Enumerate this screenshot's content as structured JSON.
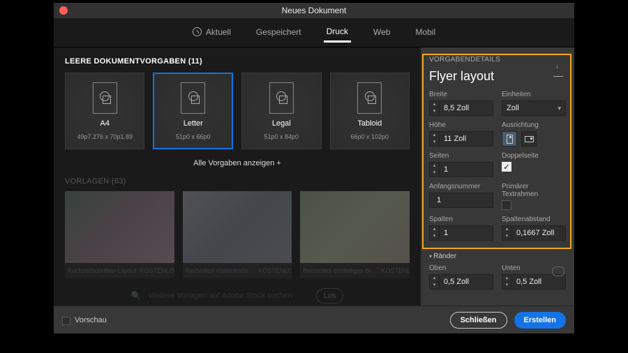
{
  "title": "Neues Dokument",
  "tabs": {
    "recent": "Aktuell",
    "saved": "Gespeichert",
    "print": "Druck",
    "web": "Web",
    "mobile": "Mobil"
  },
  "presetsHeader": "LEERE DOKUMENTVORGABEN (11)",
  "presets": [
    {
      "name": "A4",
      "sub": "49p7.276 x 70p1.89"
    },
    {
      "name": "Letter",
      "sub": "51p0 x 66p0"
    },
    {
      "name": "Legal",
      "sub": "51p0 x 84p0"
    },
    {
      "name": "Tabloid",
      "sub": "66p0 x 102p0"
    }
  ],
  "showAll": "Alle Vorgaben anzeigen +",
  "templatesHeader": "VORLAGEN (63)",
  "templates": [
    {
      "label": "Kochzeitschriften-Layout",
      "tag": "KOSTENLOS"
    },
    {
      "label": "Reizvolles Visitenkarte…",
      "tag": "KOSTENLOS"
    },
    {
      "label": "Reizvolles dreiteiliges Br…",
      "tag": "KOSTENLOS"
    }
  ],
  "stockSearch": {
    "placeholder": "Weitere Vorlagen auf Adobe Stock suchen",
    "go": "Los"
  },
  "details": {
    "title": "VORGABENDETAILS",
    "name": "Flyer layout",
    "widthLabel": "Breite",
    "widthValue": "8,5 Zoll",
    "unitsLabel": "Einheiten",
    "unitsValue": "Zoll",
    "heightLabel": "Höhe",
    "heightValue": "11 Zoll",
    "orientationLabel": "Ausrichtung",
    "pagesLabel": "Seiten",
    "pagesValue": "1",
    "facingLabel": "Doppelseite",
    "facingChecked": true,
    "startLabel": "Anfangsnummer",
    "startValue": "1",
    "primaryLabel": "Primärer Textrahmen",
    "primaryChecked": false,
    "columnsLabel": "Spalten",
    "columnsValue": "1",
    "gutterLabel": "Spaltenabstand",
    "gutterValue": "0,1667 Zoll",
    "marginsTitle": "Ränder",
    "topLabel": "Oben",
    "topValue": "0,5 Zoll",
    "bottomLabel": "Unten",
    "bottomValue": "0,5 Zoll"
  },
  "footer": {
    "preview": "Vorschau",
    "close": "Schließen",
    "create": "Erstellen"
  }
}
